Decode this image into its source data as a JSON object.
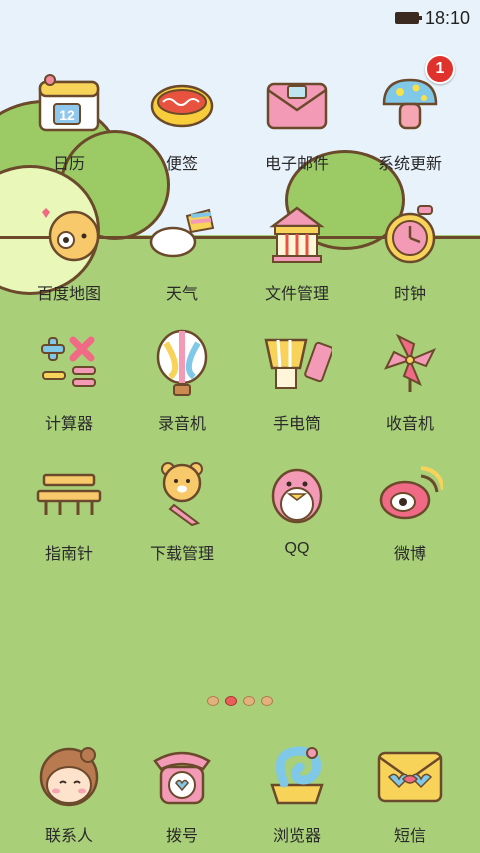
{
  "status_bar": {
    "time": "18:10"
  },
  "apps": [
    {
      "label": "日历",
      "icon": "calendar-icon"
    },
    {
      "label": "便签",
      "icon": "memo-icon"
    },
    {
      "label": "电子邮件",
      "icon": "mail-icon"
    },
    {
      "label": "系统更新",
      "icon": "mushroom-icon",
      "badge": "1"
    },
    {
      "label": "百度地图",
      "icon": "map-icon"
    },
    {
      "label": "天气",
      "icon": "cloud-icon"
    },
    {
      "label": "文件管理",
      "icon": "carousel-icon"
    },
    {
      "label": "时钟",
      "icon": "alarm-clock-icon"
    },
    {
      "label": "计算器",
      "icon": "calculator-icon"
    },
    {
      "label": "录音机",
      "icon": "balloon-icon"
    },
    {
      "label": "手电筒",
      "icon": "flashlight-icon"
    },
    {
      "label": "收音机",
      "icon": "pinwheel-icon"
    },
    {
      "label": "指南针",
      "icon": "bench-icon"
    },
    {
      "label": "下载管理",
      "icon": "bear-icon"
    },
    {
      "label": "QQ",
      "icon": "penguin-icon"
    },
    {
      "label": "微博",
      "icon": "weibo-icon"
    }
  ],
  "page_indicator": {
    "count": 4,
    "active": 1
  },
  "dock": [
    {
      "label": "联系人",
      "icon": "contacts-icon"
    },
    {
      "label": "拨号",
      "icon": "phone-icon"
    },
    {
      "label": "浏览器",
      "icon": "browser-icon"
    },
    {
      "label": "短信",
      "icon": "message-icon"
    }
  ]
}
